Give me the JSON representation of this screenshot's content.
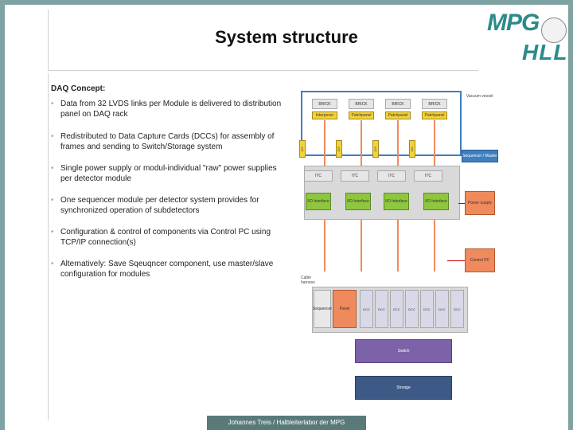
{
  "slide": {
    "title": "System structure",
    "heading": "DAQ Concept:",
    "bullets": [
      "Data from 32 LVDS links per Module is delivered to distribution panel on DAQ rack",
      "Redistributed to Data Capture Cards (DCCs) for assembly of frames and sending to Switch/Storage system",
      "Single power supply or modul-individual \"raw\" power supplies per detector module",
      "One sequencer module per detector system provides for synchronized operation of subdetectors",
      "Configuration & control of components via Control PC using TCP/IP connection(s)",
      "Alternatively: Save Sqeuqncer component, use master/slave configuration for modules"
    ],
    "footer": "Johannes Treis / Halbleiterlabor der MPG"
  },
  "logo": {
    "text_top": "MPG",
    "text_bottom": "HLL"
  },
  "diagram": {
    "vacuum_label": "Vacuum vessel",
    "brick_label": "BRICK",
    "patch_labels": [
      "Interposer",
      "Patchpanel",
      "Patchpanel",
      "Patchpanel"
    ],
    "vc_label": "V/C",
    "itc_label": "ITC",
    "iob_label": "I/O Interface",
    "sequencer_label": "Sequencer / Master",
    "power_label": "Power supply",
    "control_label": "Control PC",
    "cable_label": "Cable harness",
    "seq_box_label": "Sequencer",
    "panel_label": "Panel",
    "dcc_label": "DCC",
    "switch_label": "Switch",
    "storage_label": "Storage"
  },
  "colors": {
    "frame": "#7fa3a3",
    "accent": "#2d8a8a",
    "orange": "#f08a5d",
    "green": "#8ec63f",
    "yellow": "#f3d23a",
    "blue": "#3f7fc0",
    "purple": "#7c62a8",
    "storage": "#3d5a86"
  }
}
